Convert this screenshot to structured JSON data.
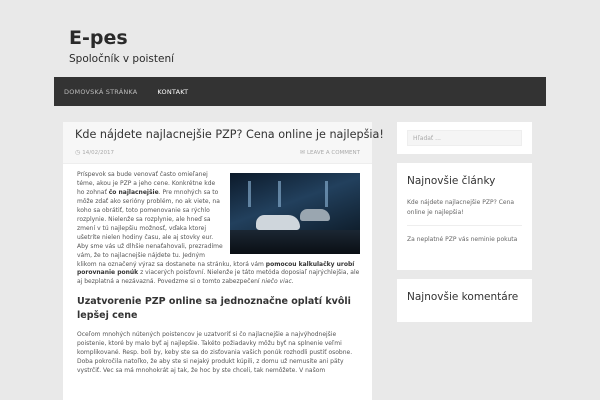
{
  "site": {
    "title": "E-pes",
    "description": "Spoločník v poistení"
  },
  "nav": {
    "items": [
      {
        "label": "DOMOVSKÁ STRÁNKA"
      },
      {
        "label": "KONTAKT"
      }
    ]
  },
  "post": {
    "title": "Kde nájdete najlacnejšie PZP? Cena online je najlepšia!",
    "date": "14/02/2017",
    "comment_link": "LEAVE A COMMENT",
    "image_icon": "sports-car-image",
    "p1_a": "Príspevok sa bude venovať často omieľanej téme, akou je PZP a jeho cene. Konkrétne kde ho zohnať ",
    "p1_b": "čo najlacnejšie",
    "p1_c": ". Pre mnohých sa to môže zdať ako serióny problém, no ak viete, na koho sa obrátiť, toto pomenovanie sa rýchlo rozplynie. Nielenže sa rozplynie, ale hneď sa zmení v tú najlepšiu možnosť, vďaka ktorej ušetríte nielen hodiny času, ale aj stovky eur. Aby sme vás už dlhšie nenaťahovali, prezradíme vám, že to najlacnejšie nájdete tu. Jedným klikom na označený výraz sa dostanete na stránku, ktorá vám ",
    "p1_d": "pomocou kalkulačky urobí porovnanie ponúk",
    "p1_e": " z viacerých poisťovní. Nielenže je táto metóda doposiaľ najrýchlejšia, ale aj bezplatná a nezávazná. Povedzme si o tomto zabezpečení ",
    "p1_f": "niečo viac",
    "p1_g": ".",
    "subheading": "Uzatvorenie PZP online sa jednoznačne oplatí kvôli lepšej cene",
    "p2": "Oceľom mnohých nútených poistencov je uzatvoriť si čo najlacnejšie a najvýhodnejšie poistenie, ktoré by malo byť aj najlepšie. Takéto požiadavky môžu byť na splnenie veľmi komplikované. Resp. boli by, keby ste sa do zisťovania vašich ponúk rozhodli pustiť osobne. Doba pokročila natoľko, že aby ste si nejaký produkt kúpili, z domu už nemusíte ani päty vystrčiť. Vec sa má mnohokrát aj tak, že hoc by ste chceli, tak nemôžete. V našom"
  },
  "sidebar": {
    "search_placeholder": "Hľadať ...",
    "recent_posts_title": "Najnovšie články",
    "recent_posts": [
      {
        "label": "Kde nájdete najlacnejšie PZP? Cena online je najlepšia!"
      },
      {
        "label": "Za neplatné PZP vás neminie pokuta"
      }
    ],
    "recent_comments_title": "Najnovšie komentáre"
  },
  "icons": {
    "date": "clock-icon",
    "comment": "comment-icon"
  },
  "colors": {
    "background": "#e9e9e9",
    "navbar": "#333333",
    "card": "#ffffff"
  }
}
